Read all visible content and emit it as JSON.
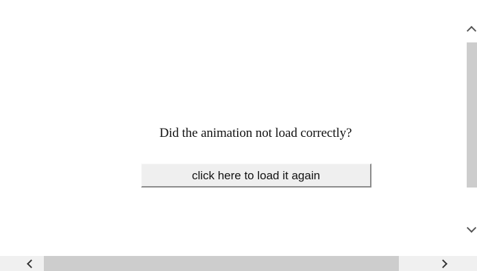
{
  "content": {
    "message": "Did the animation not load correctly?",
    "reload_button_label": "click here to load it again"
  },
  "icons": {
    "scroll_up": "chevron-up-icon",
    "scroll_down": "chevron-down-icon",
    "scroll_left": "chevron-left-icon",
    "scroll_right": "chevron-right-icon"
  },
  "colors": {
    "page_background": "#ffffff",
    "button_face": "#efefef",
    "scrollbar_track": "#f0f0f0",
    "scrollbar_thumb": "#cdcdcd"
  }
}
